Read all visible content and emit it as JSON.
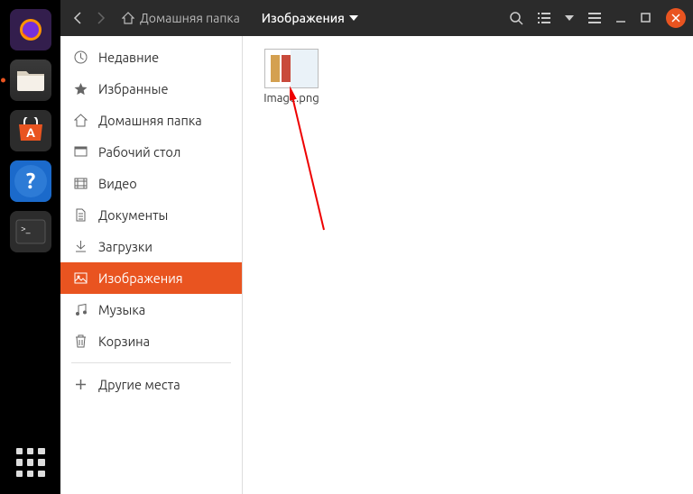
{
  "dock": {
    "items": [
      {
        "name": "firefox",
        "letter": ""
      },
      {
        "name": "files",
        "letter": ""
      },
      {
        "name": "software",
        "letter": "A"
      },
      {
        "name": "help",
        "letter": "?"
      },
      {
        "name": "terminal",
        "letter": ">_"
      }
    ]
  },
  "header": {
    "home_label": "Домашняя папка",
    "current_label": "Изображения"
  },
  "sidebar": {
    "items": [
      {
        "label": "Недавние"
      },
      {
        "label": "Избранные"
      },
      {
        "label": "Домашняя папка"
      },
      {
        "label": "Рабочий стол"
      },
      {
        "label": "Видео"
      },
      {
        "label": "Документы"
      },
      {
        "label": "Загрузки"
      },
      {
        "label": "Изображения"
      },
      {
        "label": "Музыка"
      },
      {
        "label": "Корзина"
      }
    ],
    "other_label": "Другие места"
  },
  "files": [
    {
      "name": "Image.png"
    }
  ]
}
